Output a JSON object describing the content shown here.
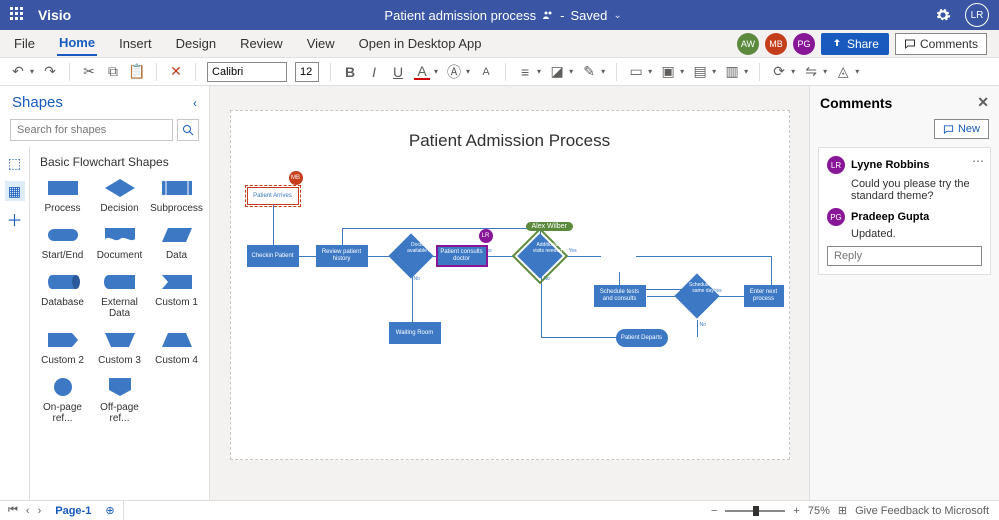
{
  "app": {
    "name": "Visio"
  },
  "document": {
    "title": "Patient admission process",
    "status": "Saved"
  },
  "user": {
    "initials": "LR"
  },
  "menu": {
    "items": [
      "File",
      "Home",
      "Insert",
      "Design",
      "Review",
      "View"
    ],
    "open_desktop": "Open in Desktop App",
    "active_index": 1
  },
  "presence": [
    {
      "initials": "AW",
      "color": "#5b8a3c"
    },
    {
      "initials": "MB",
      "color": "#c43e1c"
    },
    {
      "initials": "PG",
      "color": "#881798"
    }
  ],
  "buttons": {
    "share": "Share",
    "comments": "Comments",
    "new": "New"
  },
  "toolbar": {
    "font": "Calibri",
    "size": "12"
  },
  "shapes": {
    "title": "Shapes",
    "search_placeholder": "Search for shapes",
    "group": "Basic Flowchart Shapes",
    "items": [
      "Process",
      "Decision",
      "Subprocess",
      "Start/End",
      "Document",
      "Data",
      "Database",
      "External Data",
      "Custom 1",
      "Custom 2",
      "Custom 3",
      "Custom 4",
      "On-page ref...",
      "Off-page ref..."
    ]
  },
  "diagram": {
    "title": "Patient Admission Process",
    "nodes": {
      "patient_arrives": "Patient Arrives",
      "checkin": "Checkin Patient",
      "review_history": "Review patient history",
      "doctor_available": "Doctor available?",
      "consults": "Patient consults doctor",
      "additional_visits": "Additional visits needed",
      "waiting_room": "Waiting Room",
      "schedule_tests": "Schedule tests and consults",
      "same_day": "Scheduled for same day?",
      "next_process": "Enter next process",
      "departs": "Patient Departs"
    },
    "labels": {
      "yes": "Yes",
      "no": "No"
    },
    "badges": {
      "mb": "MB",
      "lr": "LR",
      "alex": "Alex Wilber"
    }
  },
  "comments": {
    "title": "Comments",
    "thread": {
      "author": "Lyyne Robbins",
      "author_initials": "LR",
      "author_color": "#881798",
      "body": "Could you please try the standard theme?",
      "reply_author": "Pradeep Gupta",
      "reply_initials": "PG",
      "reply_color": "#881798",
      "reply_body": "Updated.",
      "reply_placeholder": "Reply"
    }
  },
  "status": {
    "page": "Page-1",
    "zoom": "75%",
    "feedback": "Give Feedback to Microsoft"
  }
}
